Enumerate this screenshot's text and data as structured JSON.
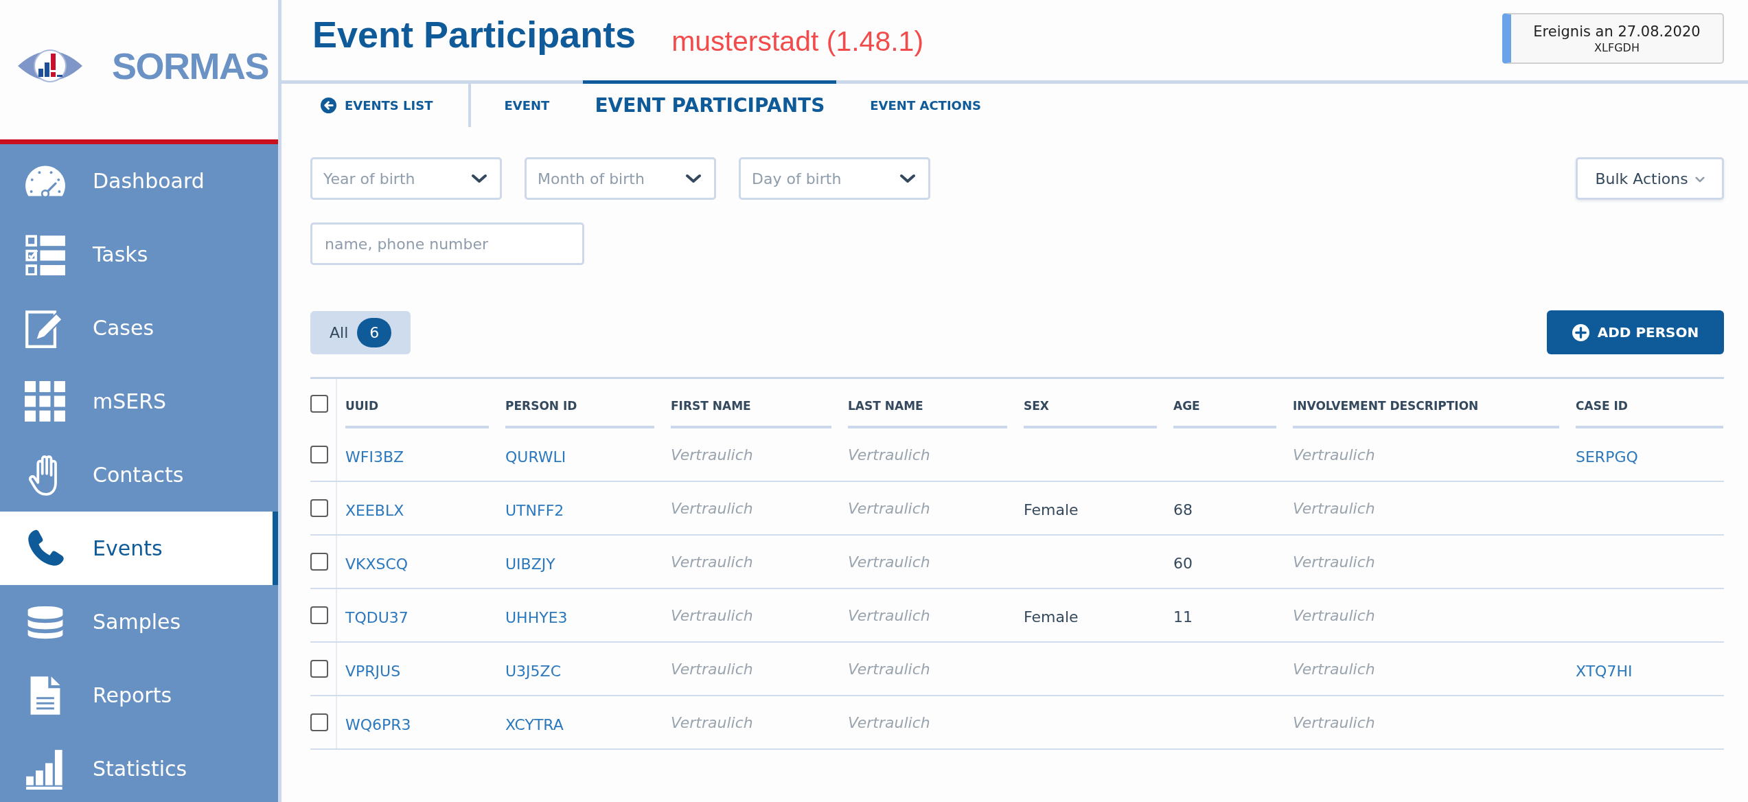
{
  "sidebar": {
    "app_name": "SORMAS",
    "items": [
      {
        "label": "Dashboard",
        "selected": false
      },
      {
        "label": "Tasks",
        "selected": false
      },
      {
        "label": "Cases",
        "selected": false
      },
      {
        "label": "mSERS",
        "selected": false
      },
      {
        "label": "Contacts",
        "selected": false
      },
      {
        "label": "Events",
        "selected": true
      },
      {
        "label": "Samples",
        "selected": false
      },
      {
        "label": "Reports",
        "selected": false
      },
      {
        "label": "Statistics",
        "selected": false
      }
    ]
  },
  "header": {
    "title": "Event Participants",
    "server_label": "musterstadt (1.48.1)",
    "event_card": {
      "title": "Ereignis an 27.08.2020",
      "code": "XLFGDH"
    }
  },
  "tabs": [
    {
      "kind": "back",
      "label": "EVENTS LIST",
      "selected": false
    },
    {
      "kind": "tab",
      "label": "EVENT",
      "selected": false
    },
    {
      "kind": "tab",
      "label": "EVENT PARTICIPANTS",
      "selected": true
    },
    {
      "kind": "tab",
      "label": "EVENT ACTIONS",
      "selected": false
    }
  ],
  "filters": {
    "dropdowns": [
      {
        "placeholder": "Year of birth"
      },
      {
        "placeholder": "Month of birth"
      },
      {
        "placeholder": "Day of birth"
      }
    ],
    "search": {
      "placeholder": "name, phone number"
    },
    "bulk_actions": {
      "label": "Bulk Actions"
    }
  },
  "view_tabs": [
    {
      "label": "All",
      "count": "6",
      "selected": true
    }
  ],
  "add_button": {
    "label": "ADD PERSON"
  },
  "table": {
    "select_all_checked": false,
    "columns": [
      {
        "label": "UUID",
        "kind": "link"
      },
      {
        "label": "PERSON ID",
        "kind": "link"
      },
      {
        "label": "FIRST NAME",
        "kind": "masked"
      },
      {
        "label": "LAST NAME",
        "kind": "masked"
      },
      {
        "label": "SEX",
        "kind": "text"
      },
      {
        "label": "AGE",
        "kind": "text"
      },
      {
        "label": "INVOLVEMENT DESCRIPTION",
        "kind": "masked"
      },
      {
        "label": "CASE ID",
        "kind": "link"
      }
    ],
    "rows": [
      {
        "checked": false,
        "uuid": "WFI3BZ",
        "person_id": "QURWLI",
        "first_name": "Vertraulich",
        "last_name": "Vertraulich",
        "involvement_description": "Vertraulich",
        "case_id": "SERPGQ"
      },
      {
        "checked": false,
        "uuid": "XEEBLX",
        "person_id": "UTNFF2",
        "first_name": "Vertraulich",
        "last_name": "Vertraulich",
        "sex": "Female",
        "age": "68",
        "involvement_description": "Vertraulich"
      },
      {
        "checked": false,
        "uuid": "VKXSCQ",
        "person_id": "UIBZJY",
        "first_name": "Vertraulich",
        "last_name": "Vertraulich",
        "age": "60",
        "involvement_description": "Vertraulich"
      },
      {
        "checked": false,
        "uuid": "TQDU37",
        "person_id": "UHHYE3",
        "first_name": "Vertraulich",
        "last_name": "Vertraulich",
        "sex": "Female",
        "age": "11",
        "involvement_description": "Vertraulich"
      },
      {
        "checked": false,
        "uuid": "VPRJUS",
        "person_id": "U3J5ZC",
        "first_name": "Vertraulich",
        "last_name": "Vertraulich",
        "involvement_description": "Vertraulich",
        "case_id": "XTQ7HI"
      },
      {
        "checked": false,
        "uuid": "WQ6PR3",
        "person_id": "XCYTRA",
        "first_name": "Vertraulich",
        "last_name": "Vertraulich",
        "involvement_description": "Vertraulich"
      }
    ]
  }
}
